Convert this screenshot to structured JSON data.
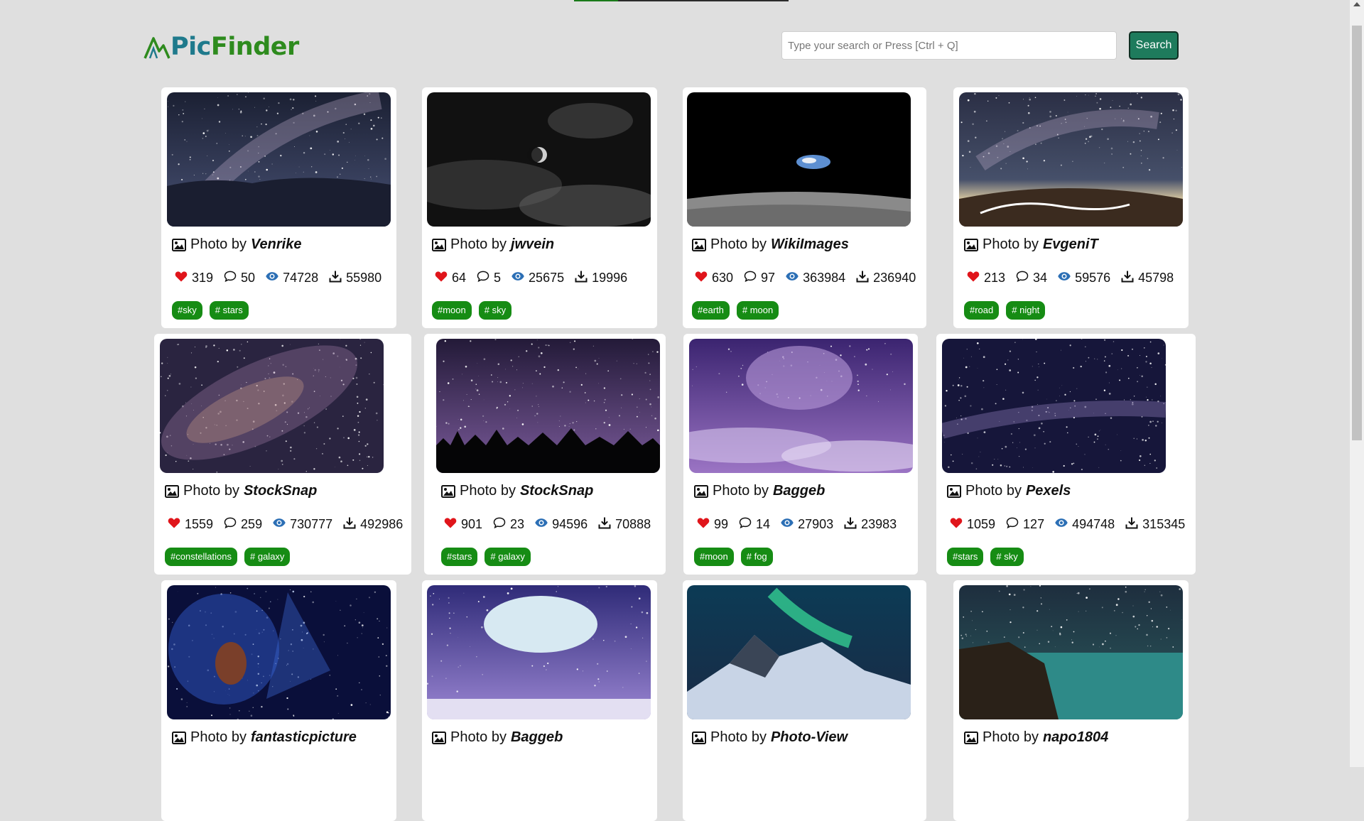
{
  "app": {
    "logo_pic": "Pic",
    "logo_finder": "Finder"
  },
  "search": {
    "placeholder": "Type your search or Press [Ctrl + Q]",
    "button_label": "Search"
  },
  "photo_prefix": "Photo by",
  "colors": {
    "accent_green": "#168c14",
    "button_teal": "#1e7b5c",
    "heart_red": "#e0151b",
    "eye_blue": "#2c6fb5"
  },
  "icons": {
    "like": "heart-icon",
    "comments": "comment-icon",
    "views": "eye-icon",
    "downloads": "download-icon",
    "photo": "image-icon"
  },
  "cards": [
    {
      "author": "Venrike",
      "likes": "319",
      "comments": "50",
      "views": "74728",
      "downloads": "55980",
      "tags": [
        "#sky",
        "# stars"
      ],
      "image": "milky-way over desert"
    },
    {
      "author": "jwvein",
      "likes": "64",
      "comments": "5",
      "views": "25675",
      "downloads": "19996",
      "tags": [
        "#moon",
        "# sky"
      ],
      "image": "moon in black and white clouds"
    },
    {
      "author": "WikiImages",
      "likes": "630",
      "comments": "97",
      "views": "363984",
      "downloads": "236940",
      "tags": [
        "#earth",
        "# moon"
      ],
      "image": "earthrise over lunar surface"
    },
    {
      "author": "EvgeniT",
      "likes": "213",
      "comments": "34",
      "views": "59576",
      "downloads": "45798",
      "tags": [
        "#road",
        "# night"
      ],
      "image": "milky way over winding road"
    },
    {
      "author": "StockSnap",
      "likes": "1559",
      "comments": "259",
      "views": "730777",
      "downloads": "492986",
      "tags": [
        "#constellations",
        "# galaxy"
      ],
      "image": "galaxy core"
    },
    {
      "author": "StockSnap",
      "likes": "901",
      "comments": "23",
      "views": "94596",
      "downloads": "70888",
      "tags": [
        "#stars",
        "# galaxy"
      ],
      "image": "purple night sky over tree line"
    },
    {
      "author": "Baggeb",
      "likes": "99",
      "comments": "14",
      "views": "27903",
      "downloads": "23983",
      "tags": [
        "#moon",
        "# fog"
      ],
      "image": "purple moon over clouds"
    },
    {
      "author": "Pexels",
      "likes": "1059",
      "comments": "127",
      "views": "494748",
      "downloads": "315345",
      "tags": [
        "#stars",
        "# sky"
      ],
      "image": "milky way band"
    },
    {
      "author": "fantasticpicture",
      "likes": "",
      "comments": "",
      "views": "",
      "downloads": "",
      "tags": [],
      "image": "woman with blue hair and stars"
    },
    {
      "author": "Baggeb",
      "likes": "",
      "comments": "",
      "views": "",
      "downloads": "",
      "tags": [],
      "image": "full moon over road"
    },
    {
      "author": "Photo-View",
      "likes": "",
      "comments": "",
      "views": "",
      "downloads": "",
      "tags": [],
      "image": "aurora over snowy mountain"
    },
    {
      "author": "napo1804",
      "likes": "",
      "comments": "",
      "views": "",
      "downloads": "",
      "tags": [],
      "image": "night coast with stars"
    }
  ]
}
